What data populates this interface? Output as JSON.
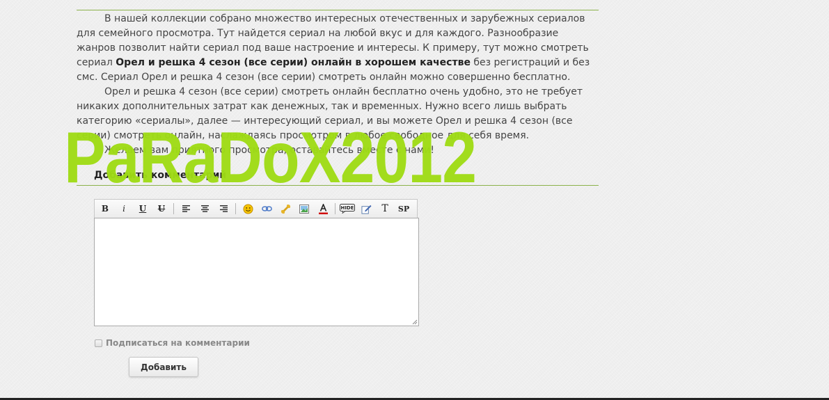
{
  "article": {
    "p1_part1": "В нашей коллекции собрано множество интересных отечественных и зарубежных сериалов для семейного просмотра. Тут найдется сериал на любой вкус и для каждого. Разнообразие жанров позволит найти сериал под ваше настроение и интересы. К примеру, тут можно смотреть сериал ",
    "p1_bold": "Орел и решка 4 сезон (все серии) онлайн в хорошем качестве",
    "p1_part2": " без регистраций и без смс. Сериал Орел и решка 4 сезон (все серии) смотреть онлайн можно совершенно бесплатно.",
    "p2": "Орел и решка 4 сезон (все серии) смотреть онлайн бесплатно очень удобно, это не требует никаких дополнительных затрат как денежных, так и временных. Нужно всего лишь выбрать категорию «сериалы», далее — интересующий сериал, и вы можете Орел и решка 4 сезон (все серии) смотреть онлайн, наслаждаясь просмотром в любое свободное для себя время.",
    "p3": "Желаем вам приятного просмотра, оставайтесь вместе с нами!"
  },
  "comments": {
    "header": "Добавить комментарий",
    "subscribe_label": "Подписаться на комментарии",
    "submit_label": "Добавить"
  },
  "toolbar": {
    "bold": "B",
    "italic": "i",
    "underline": "U",
    "strike": "U",
    "text_tool": "T",
    "spoiler": "SP",
    "hide_label": "HIDE",
    "icons": [
      "bold-icon",
      "italic-icon",
      "underline-icon",
      "strikethrough-icon",
      "align-left-icon",
      "align-center-icon",
      "align-right-icon",
      "smiley-icon",
      "link-icon",
      "bone-icon",
      "image-icon",
      "text-color-icon",
      "hide-icon",
      "edit-icon",
      "text-icon",
      "spoiler-icon"
    ]
  },
  "watermark": {
    "text": "PaRaDoX2012",
    "color": "#9fdc15"
  },
  "colors": {
    "rule": "#8bb24a",
    "background": "#efefef"
  }
}
